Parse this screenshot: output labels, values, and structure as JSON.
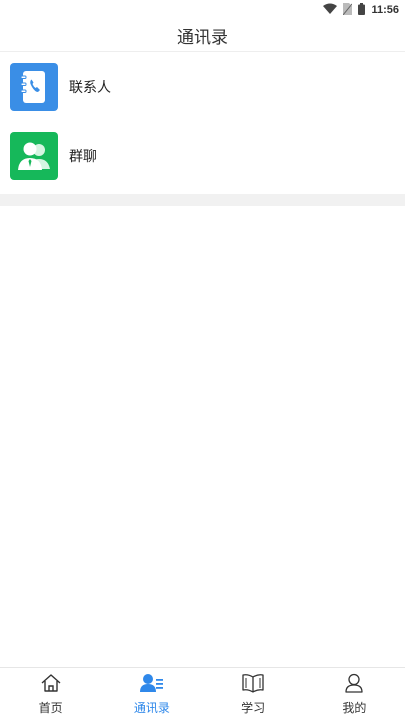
{
  "status_bar": {
    "time": "11:56"
  },
  "header": {
    "title": "通讯录"
  },
  "menu": [
    {
      "label": "联系人",
      "icon": "contact-book-icon",
      "color": "#3a8ee6"
    },
    {
      "label": "群聊",
      "icon": "group-chat-icon",
      "color": "#16b85a"
    }
  ],
  "bottom_nav": [
    {
      "label": "首页",
      "icon": "home-icon",
      "active": false
    },
    {
      "label": "通讯录",
      "icon": "contacts-icon",
      "active": true
    },
    {
      "label": "学习",
      "icon": "book-icon",
      "active": false
    },
    {
      "label": "我的",
      "icon": "profile-icon",
      "active": false
    }
  ],
  "colors": {
    "accent": "#2f88ea",
    "divider": "#f1f1f1"
  }
}
